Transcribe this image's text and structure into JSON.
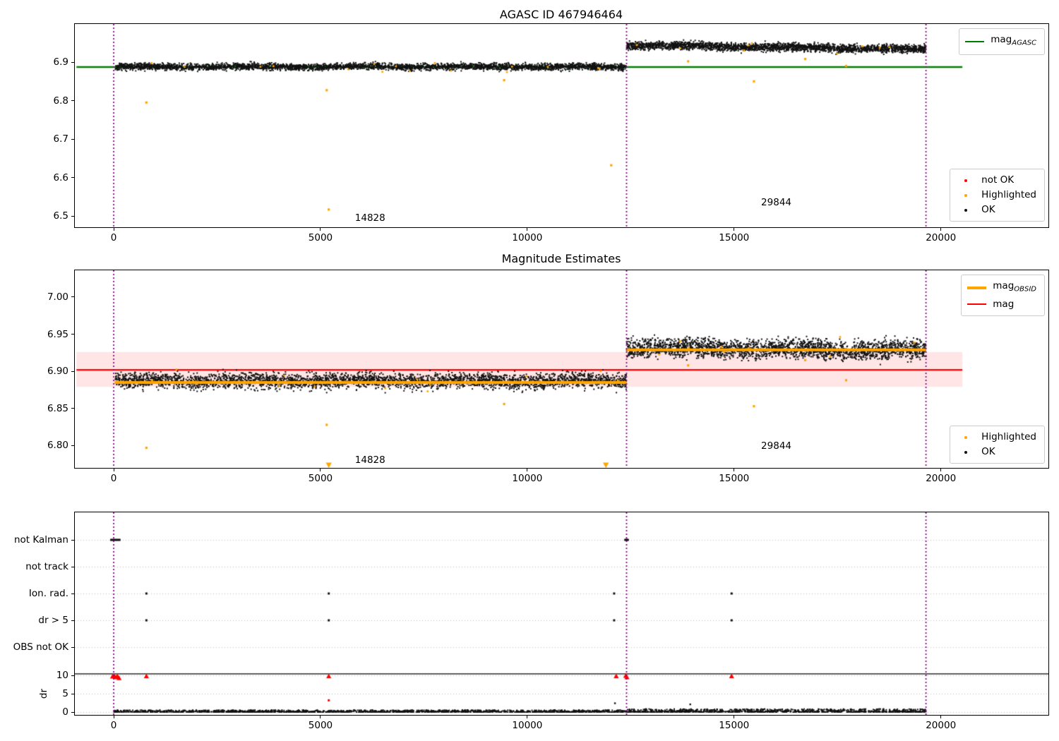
{
  "figure": {
    "background": "#ffffff"
  },
  "colors": {
    "green": "#007d00",
    "orange": "#ffa500",
    "red": "#ff0000",
    "purple": "#8b008b",
    "black": "#111111",
    "pink_band": "rgba(255,0,0,0.10)",
    "grid": "#bdbdbd",
    "legend_border": "#cccccc"
  },
  "chart_data": [
    {
      "id": "top",
      "type": "scatter",
      "title": "AGASC ID 467946464",
      "xlim": [
        -940,
        22600
      ],
      "ylim": [
        6.471,
        6.999
      ],
      "xticks": [
        0,
        5000,
        10000,
        15000,
        20000
      ],
      "xtick_labels": [
        "0",
        "5000",
        "10000",
        "15000",
        "20000"
      ],
      "yticks": [
        6.5,
        6.6,
        6.7,
        6.8,
        6.9
      ],
      "ytick_labels": [
        "6.5",
        "6.6",
        "6.7",
        "6.8",
        "6.9"
      ],
      "mag_agasc_line": {
        "y": 6.887,
        "x0": -900,
        "x1": 20520,
        "color_key": "green"
      },
      "vlines": [
        0,
        12400,
        19640
      ],
      "series_ok_segments": [
        {
          "x0": 40,
          "x1": 12395,
          "n": 3200,
          "mean": 6.888,
          "trend": 0,
          "spread": 0.0075
        },
        {
          "x0": 12400,
          "x1": 19640,
          "n": 2400,
          "mean": 6.944,
          "trend": -0.011,
          "spread": 0.009
        }
      ],
      "series_highlighted_segments": [
        {
          "x0": 150,
          "x1": 12300,
          "n": 16,
          "mean": 6.888,
          "trend": 0,
          "spread": 0.011
        },
        {
          "x0": 12500,
          "x1": 19550,
          "n": 9,
          "mean": 6.941,
          "trend": -0.008,
          "spread": 0.012
        }
      ],
      "highlighted_outliers": [
        [
          790,
          6.795
        ],
        [
          5150,
          6.827
        ],
        [
          5200,
          6.517
        ],
        [
          9440,
          6.853
        ],
        [
          12030,
          6.632
        ],
        [
          13890,
          6.902
        ],
        [
          15480,
          6.85
        ],
        [
          16720,
          6.908
        ],
        [
          17710,
          6.89
        ]
      ],
      "annotations": [
        {
          "text": "14828",
          "x": 6200,
          "y": 6.494
        },
        {
          "text": "29844",
          "x": 16020,
          "y": 6.535
        }
      ],
      "legend_upper": [
        {
          "label": "mag",
          "sub": "AGASC",
          "swatch": "line",
          "color_key": "green"
        }
      ],
      "legend_lower": [
        {
          "label": "not OK",
          "sub": "",
          "swatch": "dot",
          "color_key": "red"
        },
        {
          "label": "Highlighted",
          "sub": "",
          "swatch": "dot",
          "color_key": "orange"
        },
        {
          "label": "OK",
          "sub": "",
          "swatch": "dot",
          "color_key": "black"
        }
      ]
    },
    {
      "id": "middle",
      "type": "scatter",
      "title": "Magnitude Estimates",
      "xlim": [
        -940,
        22600
      ],
      "ylim": [
        6.77,
        7.036
      ],
      "xticks": [
        0,
        5000,
        10000,
        15000,
        20000
      ],
      "xtick_labels": [
        "0",
        "5000",
        "10000",
        "15000",
        "20000"
      ],
      "yticks": [
        6.8,
        6.85,
        6.9,
        6.95,
        7.0
      ],
      "ytick_labels": [
        "6.80",
        "6.85",
        "6.90",
        "6.95",
        "7.00"
      ],
      "mag_line": {
        "y": 6.902,
        "x0": -900,
        "x1": 20520,
        "color_key": "red"
      },
      "mag_uncertainty_band": {
        "y0": 6.879,
        "y1": 6.926,
        "x0": -900,
        "x1": 20520
      },
      "mag_obsid_lines": [
        {
          "x0": 20,
          "x1": 12395,
          "y": 6.885
        },
        {
          "x0": 12400,
          "x1": 19640,
          "y": 6.929
        }
      ],
      "vlines": [
        0,
        12400,
        19640
      ],
      "series_ok_segments": [
        {
          "x0": 40,
          "x1": 12395,
          "n": 3200,
          "mean": 6.887,
          "trend": 0,
          "spread": 0.009
        },
        {
          "x0": 12400,
          "x1": 19640,
          "n": 2400,
          "mean": 6.932,
          "trend": -0.004,
          "spread": 0.011
        }
      ],
      "series_highlighted_segments": [
        {
          "x0": 150,
          "x1": 12300,
          "n": 18,
          "mean": 6.886,
          "trend": 0,
          "spread": 0.013
        },
        {
          "x0": 12500,
          "x1": 19550,
          "n": 10,
          "mean": 6.931,
          "trend": -0.004,
          "spread": 0.013
        }
      ],
      "highlighted_outliers": [
        [
          790,
          6.797
        ],
        [
          5150,
          6.828
        ],
        [
          9440,
          6.856
        ],
        [
          13890,
          6.908
        ],
        [
          15480,
          6.853
        ],
        [
          16720,
          6.915
        ],
        [
          17710,
          6.888
        ]
      ],
      "clipped_low_markers": [
        5200,
        11900
      ],
      "annotations": [
        {
          "text": "14828",
          "x": 6200,
          "y": 6.78
        },
        {
          "text": "29844",
          "x": 16020,
          "y": 6.799
        }
      ],
      "legend_upper": [
        {
          "label": "mag",
          "sub": "OBSID",
          "swatch": "thickline",
          "color_key": "orange"
        },
        {
          "label": "mag",
          "sub": "",
          "swatch": "line",
          "color_key": "red"
        }
      ],
      "legend_lower": [
        {
          "label": "Highlighted",
          "sub": "",
          "swatch": "dot",
          "color_key": "orange"
        },
        {
          "label": "OK",
          "sub": "",
          "swatch": "dot",
          "color_key": "black"
        }
      ]
    },
    {
      "id": "bottom",
      "type": "flags",
      "xlim": [
        -940,
        22600
      ],
      "xticks": [
        0,
        5000,
        10000,
        15000,
        20000
      ],
      "xtick_labels": [
        "0",
        "5000",
        "10000",
        "15000",
        "20000"
      ],
      "categories": [
        "not Kalman",
        "not track",
        "Ion. rad.",
        "dr > 5",
        "OBS not OK"
      ],
      "dr_axis": {
        "label": "dr",
        "ticks": [
          10,
          5,
          0
        ],
        "tick_labels": [
          "10",
          "5",
          "0"
        ]
      },
      "flag_points": {
        "not Kalman": [
          -60,
          -20,
          20,
          60,
          100,
          140,
          12370,
          12400,
          12430
        ],
        "not track": [],
        "Ion. rad.": [
          790,
          5200,
          12100,
          14940
        ],
        "dr > 5": [
          790,
          5200,
          12100,
          14940
        ],
        "OBS not OK": []
      },
      "dr_red_triangles": [
        [
          -30,
          9.7
        ],
        [
          10,
          9.9
        ],
        [
          50,
          9.5
        ],
        [
          90,
          9.8
        ],
        [
          130,
          9.3
        ],
        [
          790,
          9.8
        ],
        [
          5200,
          9.8
        ],
        [
          12150,
          9.8
        ],
        [
          12380,
          9.9
        ],
        [
          12410,
          9.5
        ],
        [
          14940,
          9.8
        ]
      ],
      "dr_red_points": [
        [
          5200,
          3.2
        ]
      ],
      "dr_black_points": [
        [
          12120,
          2.4
        ],
        [
          13940,
          2.1
        ]
      ],
      "dr_ok_band": {
        "x0": 0,
        "x1": 19640,
        "n": 2600,
        "max_before": 0.55,
        "max_after": 0.85,
        "break_x": 12400
      },
      "separator_line_dr": 10.4,
      "vlines": [
        0,
        12400,
        19640
      ]
    }
  ]
}
